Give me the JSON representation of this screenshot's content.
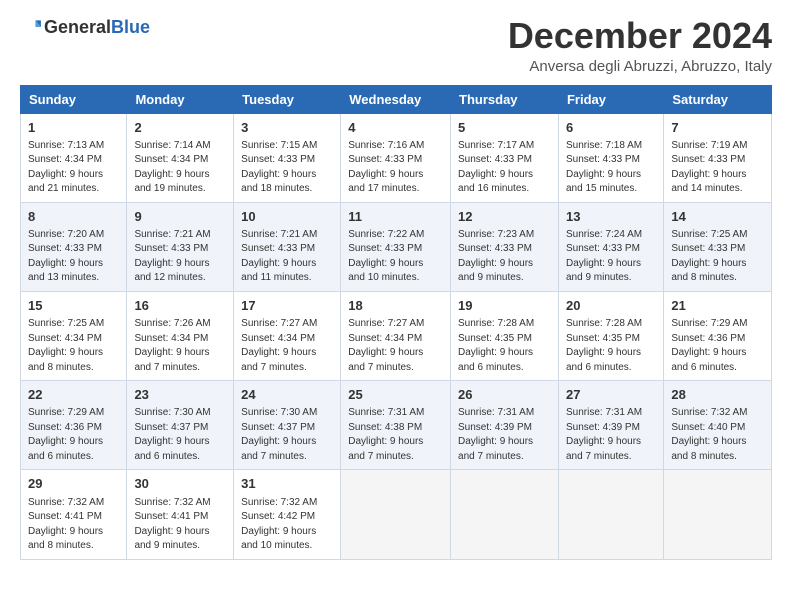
{
  "logo": {
    "text_general": "General",
    "text_blue": "Blue"
  },
  "header": {
    "month": "December 2024",
    "location": "Anversa degli Abruzzi, Abruzzo, Italy"
  },
  "weekdays": [
    "Sunday",
    "Monday",
    "Tuesday",
    "Wednesday",
    "Thursday",
    "Friday",
    "Saturday"
  ],
  "weeks": [
    [
      {
        "day": "1",
        "info": "Sunrise: 7:13 AM\nSunset: 4:34 PM\nDaylight: 9 hours\nand 21 minutes."
      },
      {
        "day": "2",
        "info": "Sunrise: 7:14 AM\nSunset: 4:34 PM\nDaylight: 9 hours\nand 19 minutes."
      },
      {
        "day": "3",
        "info": "Sunrise: 7:15 AM\nSunset: 4:33 PM\nDaylight: 9 hours\nand 18 minutes."
      },
      {
        "day": "4",
        "info": "Sunrise: 7:16 AM\nSunset: 4:33 PM\nDaylight: 9 hours\nand 17 minutes."
      },
      {
        "day": "5",
        "info": "Sunrise: 7:17 AM\nSunset: 4:33 PM\nDaylight: 9 hours\nand 16 minutes."
      },
      {
        "day": "6",
        "info": "Sunrise: 7:18 AM\nSunset: 4:33 PM\nDaylight: 9 hours\nand 15 minutes."
      },
      {
        "day": "7",
        "info": "Sunrise: 7:19 AM\nSunset: 4:33 PM\nDaylight: 9 hours\nand 14 minutes."
      }
    ],
    [
      {
        "day": "8",
        "info": "Sunrise: 7:20 AM\nSunset: 4:33 PM\nDaylight: 9 hours\nand 13 minutes."
      },
      {
        "day": "9",
        "info": "Sunrise: 7:21 AM\nSunset: 4:33 PM\nDaylight: 9 hours\nand 12 minutes."
      },
      {
        "day": "10",
        "info": "Sunrise: 7:21 AM\nSunset: 4:33 PM\nDaylight: 9 hours\nand 11 minutes."
      },
      {
        "day": "11",
        "info": "Sunrise: 7:22 AM\nSunset: 4:33 PM\nDaylight: 9 hours\nand 10 minutes."
      },
      {
        "day": "12",
        "info": "Sunrise: 7:23 AM\nSunset: 4:33 PM\nDaylight: 9 hours\nand 9 minutes."
      },
      {
        "day": "13",
        "info": "Sunrise: 7:24 AM\nSunset: 4:33 PM\nDaylight: 9 hours\nand 9 minutes."
      },
      {
        "day": "14",
        "info": "Sunrise: 7:25 AM\nSunset: 4:33 PM\nDaylight: 9 hours\nand 8 minutes."
      }
    ],
    [
      {
        "day": "15",
        "info": "Sunrise: 7:25 AM\nSunset: 4:34 PM\nDaylight: 9 hours\nand 8 minutes."
      },
      {
        "day": "16",
        "info": "Sunrise: 7:26 AM\nSunset: 4:34 PM\nDaylight: 9 hours\nand 7 minutes."
      },
      {
        "day": "17",
        "info": "Sunrise: 7:27 AM\nSunset: 4:34 PM\nDaylight: 9 hours\nand 7 minutes."
      },
      {
        "day": "18",
        "info": "Sunrise: 7:27 AM\nSunset: 4:34 PM\nDaylight: 9 hours\nand 7 minutes."
      },
      {
        "day": "19",
        "info": "Sunrise: 7:28 AM\nSunset: 4:35 PM\nDaylight: 9 hours\nand 6 minutes."
      },
      {
        "day": "20",
        "info": "Sunrise: 7:28 AM\nSunset: 4:35 PM\nDaylight: 9 hours\nand 6 minutes."
      },
      {
        "day": "21",
        "info": "Sunrise: 7:29 AM\nSunset: 4:36 PM\nDaylight: 9 hours\nand 6 minutes."
      }
    ],
    [
      {
        "day": "22",
        "info": "Sunrise: 7:29 AM\nSunset: 4:36 PM\nDaylight: 9 hours\nand 6 minutes."
      },
      {
        "day": "23",
        "info": "Sunrise: 7:30 AM\nSunset: 4:37 PM\nDaylight: 9 hours\nand 6 minutes."
      },
      {
        "day": "24",
        "info": "Sunrise: 7:30 AM\nSunset: 4:37 PM\nDaylight: 9 hours\nand 7 minutes."
      },
      {
        "day": "25",
        "info": "Sunrise: 7:31 AM\nSunset: 4:38 PM\nDaylight: 9 hours\nand 7 minutes."
      },
      {
        "day": "26",
        "info": "Sunrise: 7:31 AM\nSunset: 4:39 PM\nDaylight: 9 hours\nand 7 minutes."
      },
      {
        "day": "27",
        "info": "Sunrise: 7:31 AM\nSunset: 4:39 PM\nDaylight: 9 hours\nand 7 minutes."
      },
      {
        "day": "28",
        "info": "Sunrise: 7:32 AM\nSunset: 4:40 PM\nDaylight: 9 hours\nand 8 minutes."
      }
    ],
    [
      {
        "day": "29",
        "info": "Sunrise: 7:32 AM\nSunset: 4:41 PM\nDaylight: 9 hours\nand 8 minutes."
      },
      {
        "day": "30",
        "info": "Sunrise: 7:32 AM\nSunset: 4:41 PM\nDaylight: 9 hours\nand 9 minutes."
      },
      {
        "day": "31",
        "info": "Sunrise: 7:32 AM\nSunset: 4:42 PM\nDaylight: 9 hours\nand 10 minutes."
      },
      {
        "day": "",
        "info": ""
      },
      {
        "day": "",
        "info": ""
      },
      {
        "day": "",
        "info": ""
      },
      {
        "day": "",
        "info": ""
      }
    ]
  ]
}
